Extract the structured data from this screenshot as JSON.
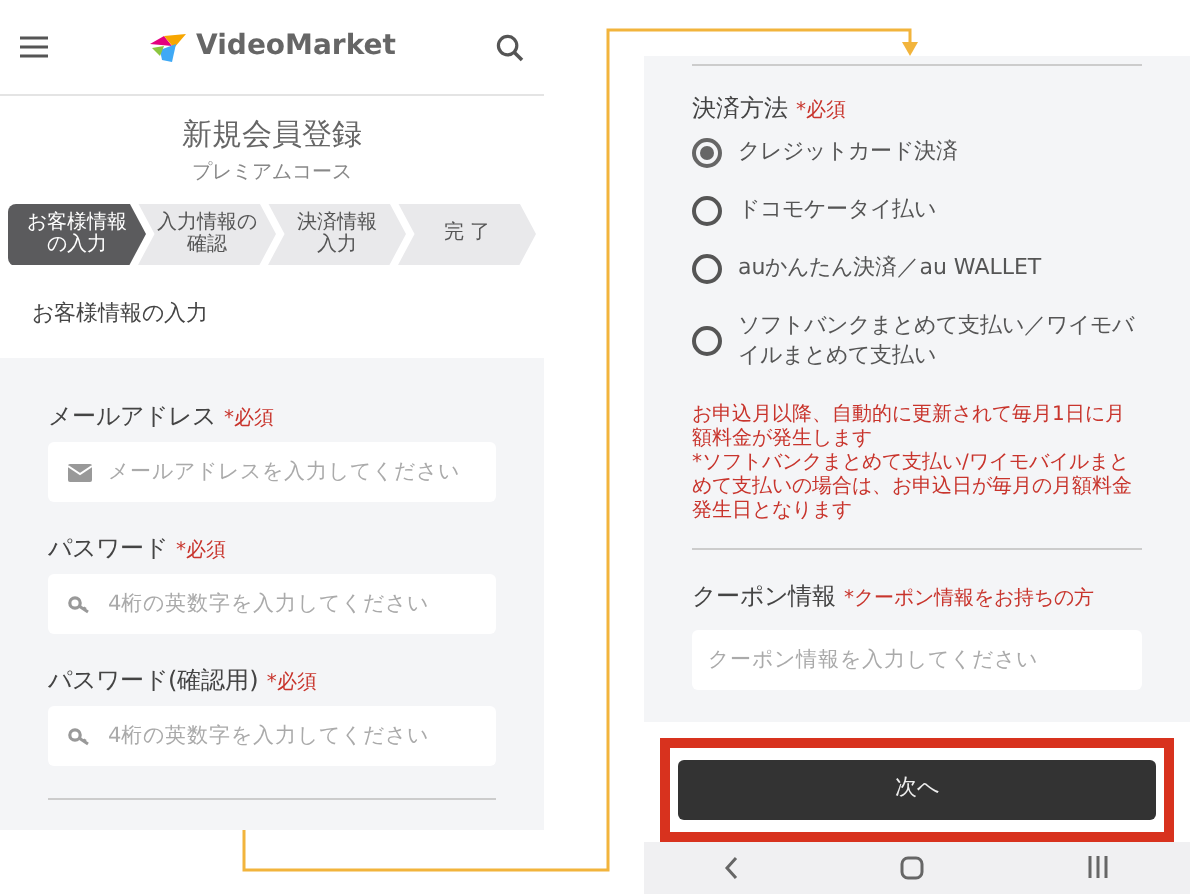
{
  "left_screen": {
    "logo": "VideoMarket",
    "title": "新規会員登録",
    "subtitle": "プレミアムコース",
    "steps": [
      {
        "lines": [
          "お客様情報",
          "の入力"
        ],
        "selected": true
      },
      {
        "lines": [
          "入力情報の",
          "確認"
        ],
        "selected": false
      },
      {
        "lines": [
          "決済情報",
          "入力"
        ],
        "selected": false
      },
      {
        "lines": [
          "完 了"
        ],
        "selected": false
      }
    ],
    "section_heading": "お客様情報の入力",
    "fields": [
      {
        "label": "メールアドレス",
        "required": "*必須",
        "placeholder": "メールアドレスを入力してください",
        "kind": "mail"
      },
      {
        "label": "パスワード",
        "required": "*必須",
        "placeholder": "4桁の英数字を入力してください",
        "kind": "key"
      },
      {
        "label": "パスワード(確認用)",
        "required": "*必須",
        "placeholder": "4桁の英数字を入力してください",
        "kind": "key"
      }
    ]
  },
  "right_screen": {
    "payment": {
      "label": "決済方法",
      "required": "*必須",
      "options": [
        {
          "label": "クレジットカード決済",
          "selected": true
        },
        {
          "label": "ドコモケータイ払い",
          "selected": false
        },
        {
          "label": "auかんたん決済／au WALLET",
          "selected": false
        },
        {
          "label": "ソフトバンクまとめて支払い／ワイモバイルまとめて支払い",
          "selected": false
        }
      ]
    },
    "notes": [
      "お申込月以降、自動的に更新されて毎月1日に月額料金が発生します",
      "*ソフトバンクまとめて支払い/ワイモバイルまとめて支払いの場合は、お申込日が毎月の月額料金発生日となります"
    ],
    "coupon": {
      "label": "クーポン情報",
      "note": "*クーポン情報をお持ちの方",
      "placeholder": "クーポン情報を入力してください"
    },
    "next_button": "次へ"
  }
}
